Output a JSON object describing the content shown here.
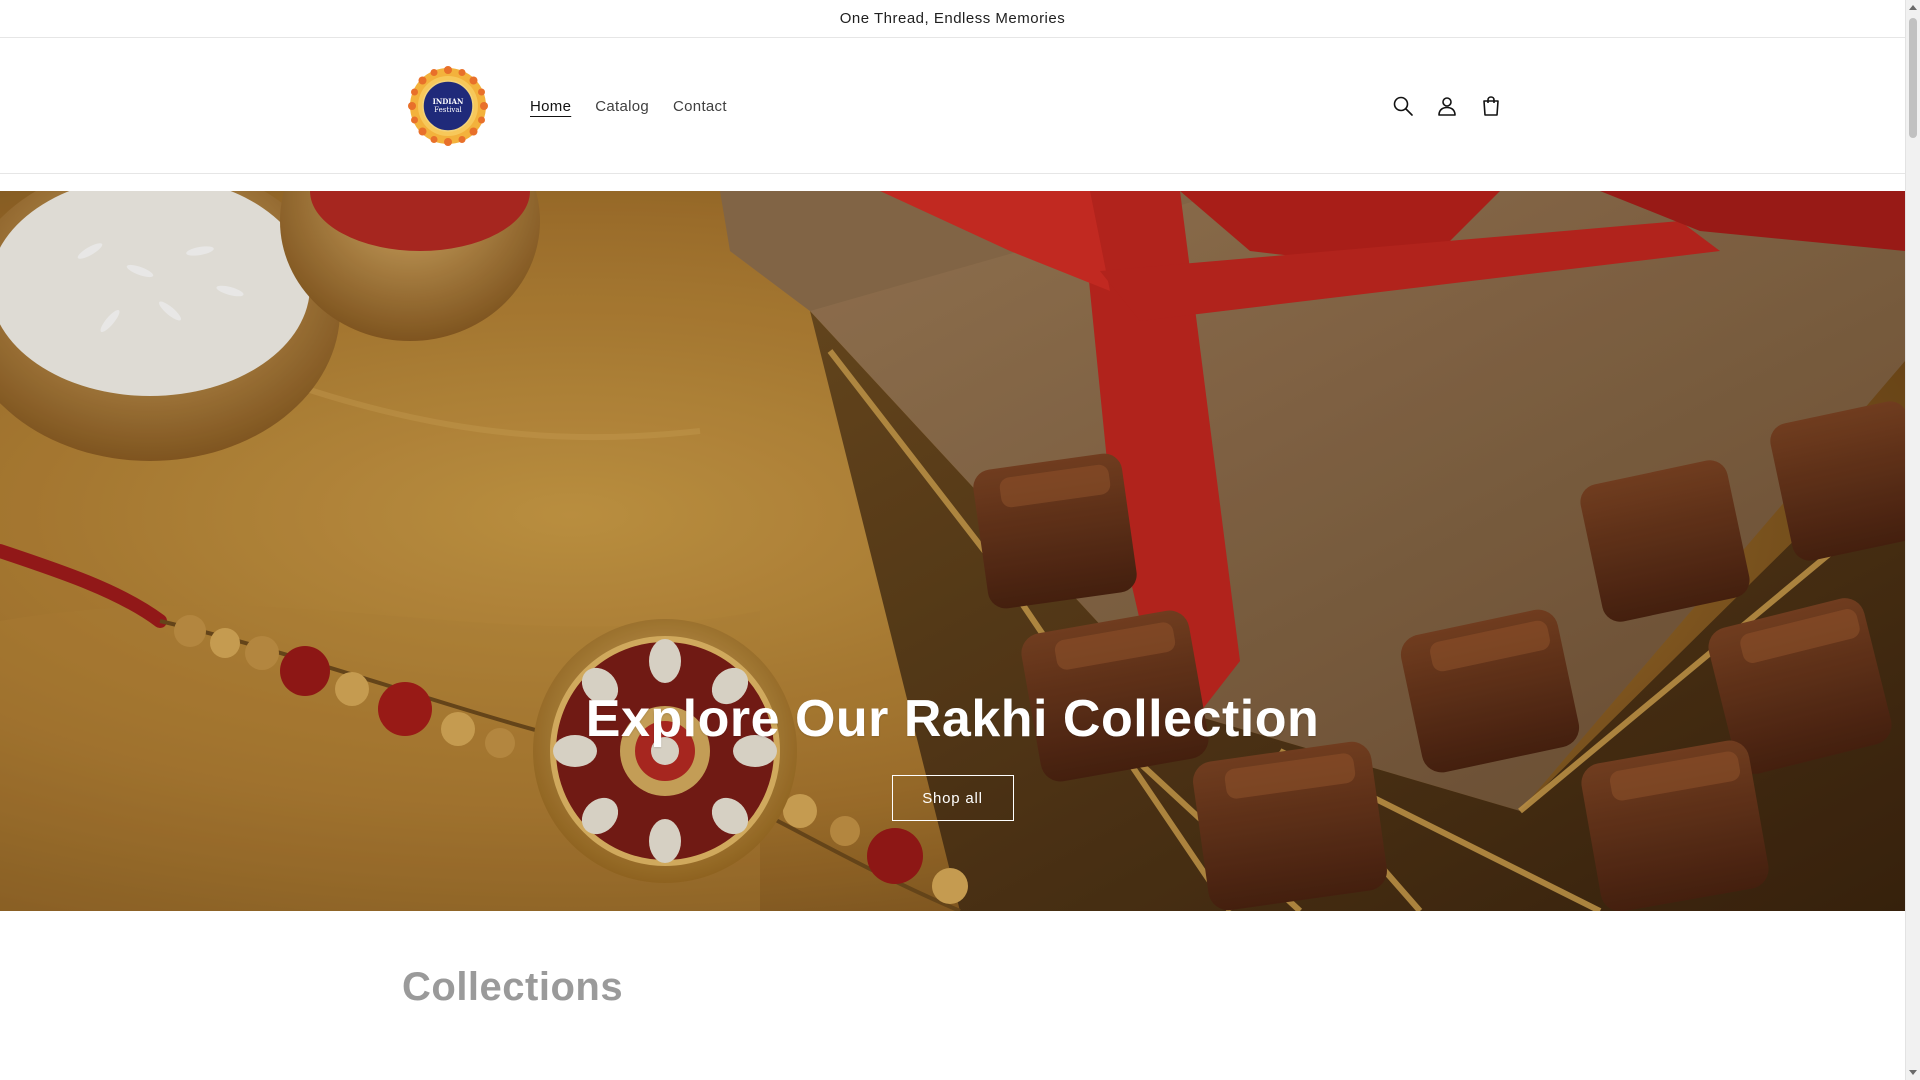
{
  "announcement": {
    "text": "One Thread, Endless Memories"
  },
  "header": {
    "logo_text": [
      "INDIAN",
      "Festival"
    ],
    "nav": [
      {
        "label": "Home",
        "active": true
      },
      {
        "label": "Catalog",
        "active": false
      },
      {
        "label": "Contact",
        "active": false
      }
    ],
    "icons": [
      "search-icon",
      "account-icon",
      "cart-icon"
    ]
  },
  "hero": {
    "title": "Explore Our Rakhi Collection",
    "button_label": "Shop all"
  },
  "collections": {
    "title": "Collections"
  },
  "colors": {
    "hero_gold": "#b8822f",
    "ribbon_red": "#c0261f",
    "chocolate": "#5a2c15",
    "logo_navy": "#1f2a7a",
    "logo_orange": "#e8702a"
  }
}
